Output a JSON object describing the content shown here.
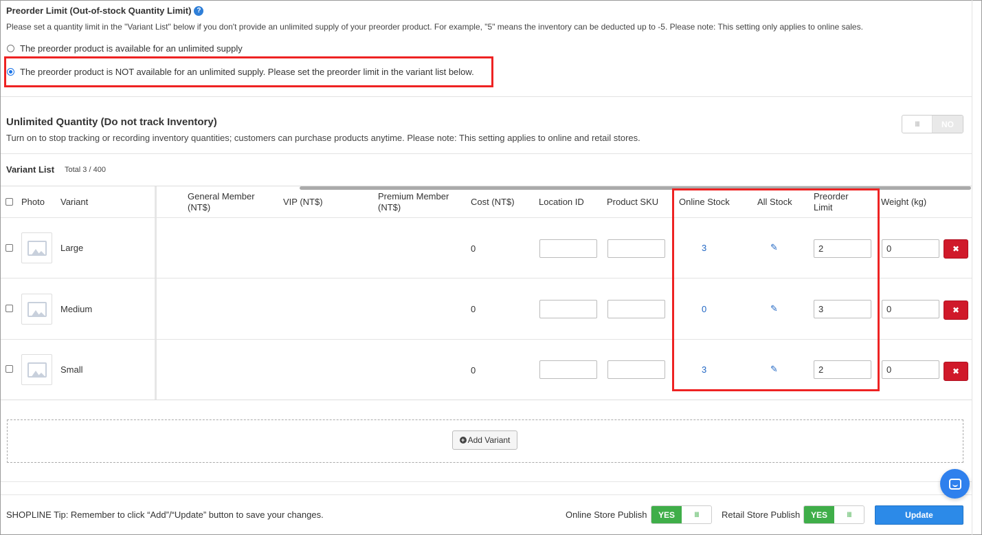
{
  "preorder": {
    "title": "Preorder Limit (Out-of-stock Quantity Limit)",
    "help_glyph": "?",
    "description": "Please set a quantity limit in the \"Variant List\" below if you don't provide an unlimited supply of your preorder product. For example, \"5\" means the inventory can be deducted up to -5. Please note: This setting only applies to online sales.",
    "options": [
      {
        "label": "The preorder product is available for an unlimited supply",
        "checked": false
      },
      {
        "label": "The preorder product is NOT available for an unlimited supply. Please set the preorder limit in the variant list below.",
        "checked": true
      }
    ]
  },
  "unlimited": {
    "title": "Unlimited Quantity (Do not track Inventory)",
    "description": "Turn on to stop tracking or recording inventory quantities; customers can purchase products anytime. Please note: This setting applies to online and retail stores.",
    "toggle_label": "NO",
    "toggle_knob": "III"
  },
  "variant_list": {
    "title": "Variant List",
    "total": "Total 3 / 400",
    "columns": {
      "photo": "Photo",
      "variant": "Variant",
      "general_member": "General Member (NT$)",
      "vip": "VIP (NT$)",
      "premium_member": "Premium Member (NT$)",
      "cost": "Cost (NT$)",
      "location_id": "Location ID",
      "product_sku": "Product SKU",
      "online_stock": "Online Stock",
      "all_stock": "All Stock",
      "preorder_limit": "Preorder Limit",
      "weight": "Weight (kg)"
    },
    "rows": [
      {
        "variant": "Large",
        "cost": "0",
        "location_id": "",
        "sku": "",
        "online_stock": "3",
        "preorder_limit": "2",
        "weight": "0"
      },
      {
        "variant": "Medium",
        "cost": "0",
        "location_id": "",
        "sku": "",
        "online_stock": "0",
        "preorder_limit": "3",
        "weight": "0"
      },
      {
        "variant": "Small",
        "cost": "0",
        "location_id": "",
        "sku": "",
        "online_stock": "3",
        "preorder_limit": "2",
        "weight": "0"
      }
    ],
    "add_variant_label": "Add Variant",
    "delete_glyph": "✖",
    "edit_glyph": "✎",
    "add_glyph": "+"
  },
  "footer": {
    "tip": "SHOPLINE Tip: Remember to click “Add”/“Update” button to save your changes.",
    "online_publish_label": "Online Store Publish",
    "retail_publish_label": "Retail Store Publish",
    "toggle_yes": "YES",
    "toggle_knob": "III",
    "update_label": "Update"
  },
  "colors": {
    "accent_blue": "#2c8ae8",
    "highlight_red": "#ee2222",
    "toggle_green": "#3fae49",
    "delete_red": "#d0192a"
  }
}
